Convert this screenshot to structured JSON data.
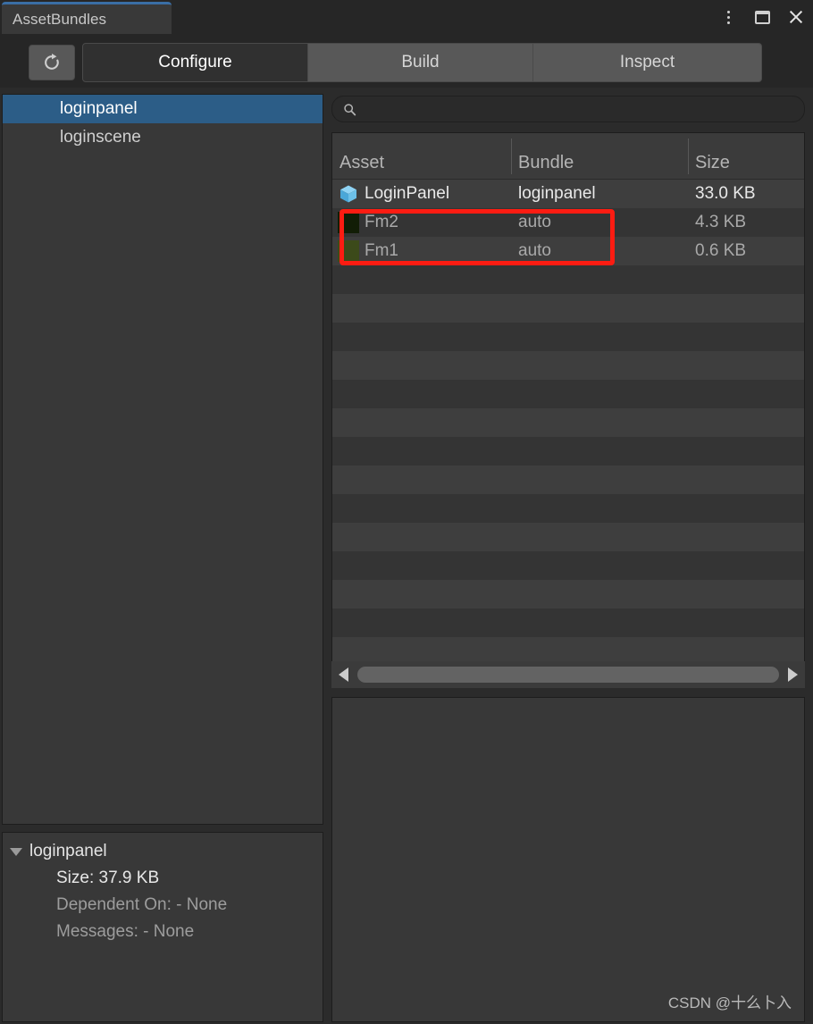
{
  "window": {
    "tab_title": "AssetBundles",
    "controls": [
      {
        "name": "more-options-icon",
        "label": "⋮"
      },
      {
        "name": "maximize-icon",
        "label": "❑"
      },
      {
        "name": "close-icon",
        "label": "✕"
      }
    ]
  },
  "toolbar": {
    "refresh_icon": "refresh-icon",
    "refresh_tooltip": "Refresh",
    "tabs": [
      {
        "label": "Configure",
        "active": true
      },
      {
        "label": "Build",
        "active": false
      },
      {
        "label": "Inspect",
        "active": false
      }
    ]
  },
  "sidebar": {
    "items": [
      {
        "label": "loginpanel",
        "selected": true
      },
      {
        "label": "loginscene",
        "selected": false
      }
    ]
  },
  "bundle_detail": {
    "expander_icon": "triangle-down-icon",
    "name": "loginpanel",
    "size_line": "Size: 37.9 KB",
    "dependent_line": "Dependent On: - None",
    "messages_line": "Messages: - None"
  },
  "search": {
    "icon": "search-icon",
    "value": "",
    "placeholder": ""
  },
  "asset_table": {
    "columns": [
      "Asset",
      "Bundle",
      "Size"
    ],
    "rows": [
      {
        "icon": "prefab-cube-icon",
        "asset": "LoginPanel",
        "bundle": "loginpanel",
        "size": "33.0 KB"
      },
      {
        "icon": "texture-thumbnail-dark-icon",
        "asset": "Fm2",
        "bundle": "auto",
        "size": "4.3 KB"
      },
      {
        "icon": "texture-thumbnail-olive-icon",
        "asset": "Fm1",
        "bundle": "auto",
        "size": "0.6 KB"
      }
    ],
    "empty_row_count": 14
  },
  "annotation": {
    "color": "#fc1c12",
    "highlights": [
      "Fm2",
      "Fm1"
    ]
  },
  "scrollbar": {
    "left_arrow": "triangle-left-icon",
    "right_arrow": "triangle-right-icon"
  },
  "inspector": {
    "content": ""
  },
  "watermark": {
    "text": "CSDN @十么卜入"
  },
  "colors": {
    "accent_selection": "#2c5d87",
    "tab_accent": "#3a6ea5",
    "annotation_red": "#fc1c12",
    "panel_bg": "#383838",
    "row_odd": "#3e3e3e",
    "row_even": "#343434"
  }
}
